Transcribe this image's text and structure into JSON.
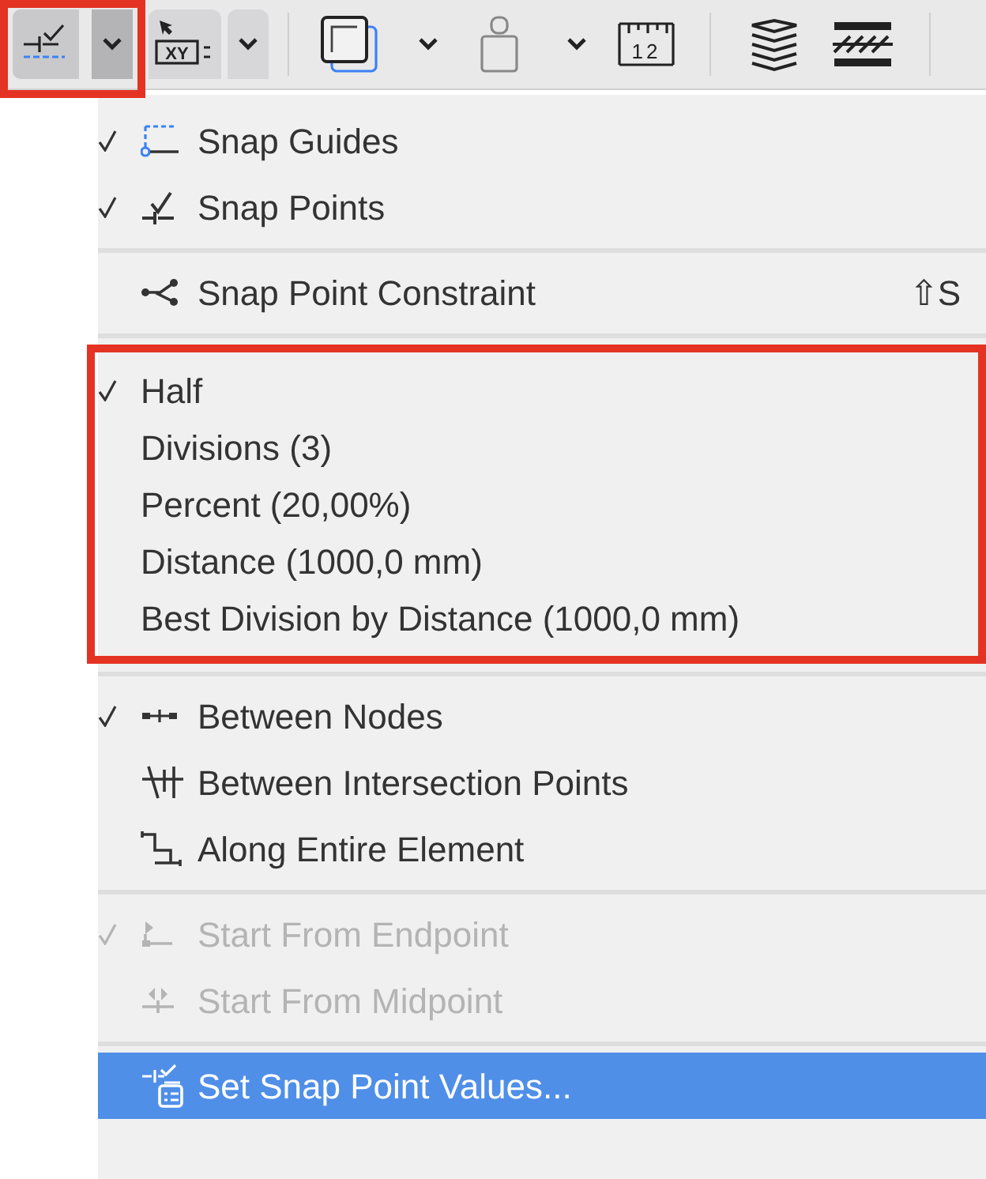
{
  "toolbar": {
    "groups": [
      {
        "kind": "snap",
        "annotated": true
      },
      {
        "kind": "coordinates",
        "annotated": false,
        "label": "XY"
      },
      {
        "kind": "layer",
        "annotated": false
      },
      {
        "kind": "weight",
        "annotated": false
      },
      {
        "kind": "ruler",
        "annotated": false,
        "label": "12"
      },
      {
        "kind": "layers",
        "annotated": false
      },
      {
        "kind": "hatch",
        "annotated": false
      }
    ]
  },
  "menu": {
    "sections": [
      {
        "annotated": false,
        "items": [
          {
            "kind": "snap-guides",
            "label": "Snap Guides",
            "checked": true,
            "disabled": false,
            "selected": false
          },
          {
            "kind": "snap-points",
            "label": "Snap Points",
            "checked": true,
            "disabled": false,
            "selected": false
          }
        ]
      },
      {
        "annotated": false,
        "items": [
          {
            "kind": "constraint",
            "label": "Snap Point Constraint",
            "shortcut": "⇧S",
            "checked": false,
            "disabled": false,
            "selected": false
          }
        ]
      },
      {
        "annotated": true,
        "items": [
          {
            "kind": "plain",
            "label": "Half",
            "checked": true,
            "disabled": false,
            "selected": false
          },
          {
            "kind": "plain",
            "label": "Divisions (3)",
            "checked": false,
            "disabled": false,
            "selected": false
          },
          {
            "kind": "plain",
            "label": "Percent (20,00%)",
            "checked": false,
            "disabled": false,
            "selected": false
          },
          {
            "kind": "plain",
            "label": "Distance (1000,0 mm)",
            "checked": false,
            "disabled": false,
            "selected": false
          },
          {
            "kind": "plain",
            "label": "Best Division by Distance (1000,0 mm)",
            "checked": false,
            "disabled": false,
            "selected": false
          }
        ]
      },
      {
        "annotated": false,
        "items": [
          {
            "kind": "nodes",
            "label": "Between Nodes",
            "checked": true,
            "disabled": false,
            "selected": false
          },
          {
            "kind": "intersection",
            "label": "Between Intersection Points",
            "checked": false,
            "disabled": false,
            "selected": false
          },
          {
            "kind": "along",
            "label": "Along Entire Element",
            "checked": false,
            "disabled": false,
            "selected": false
          }
        ]
      },
      {
        "annotated": false,
        "items": [
          {
            "kind": "endpoint",
            "label": "Start From Endpoint",
            "checked": true,
            "disabled": true,
            "selected": false
          },
          {
            "kind": "midpoint",
            "label": "Start From Midpoint",
            "checked": false,
            "disabled": true,
            "selected": false
          }
        ]
      },
      {
        "annotated": false,
        "items": [
          {
            "kind": "values",
            "label": "Set Snap Point Values...",
            "checked": false,
            "disabled": false,
            "selected": true
          }
        ]
      }
    ]
  }
}
